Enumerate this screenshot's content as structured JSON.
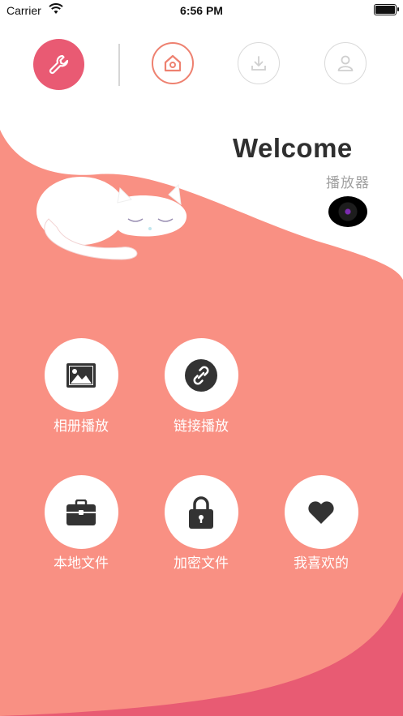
{
  "status_bar": {
    "carrier": "Carrier",
    "time": "6:56 PM"
  },
  "nav": {
    "settings_icon": "wrench-icon",
    "home_icon": "home-icon",
    "download_icon": "download-icon",
    "profile_icon": "user-icon"
  },
  "hero": {
    "title": "Welcome",
    "subtitle": "播放器"
  },
  "menu": [
    {
      "label": "相册播放",
      "icon": "image-icon"
    },
    {
      "label": "链接播放",
      "icon": "link-icon"
    },
    {
      "label": "本地文件",
      "icon": "briefcase-icon"
    },
    {
      "label": "加密文件",
      "icon": "lock-icon"
    },
    {
      "label": "我喜欢的",
      "icon": "heart-icon"
    }
  ],
  "colors": {
    "accent": "#e95a73",
    "background_coral": "#f99083",
    "background_deep": "#e85b73",
    "home_ring": "#ee8170"
  }
}
